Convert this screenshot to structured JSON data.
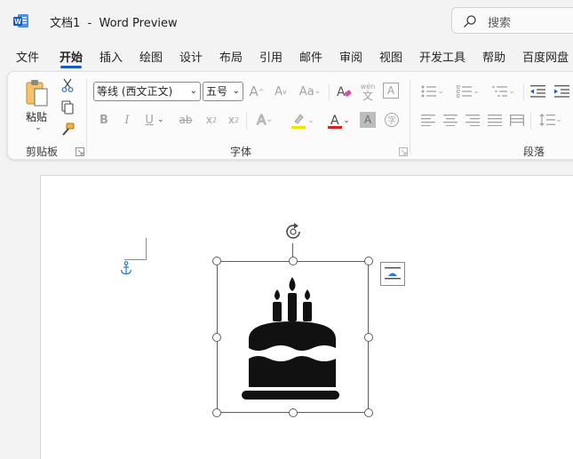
{
  "titlebar": {
    "doc_name": "文档1",
    "separator": "-",
    "app_name": "Word Preview",
    "search_placeholder": "搜索"
  },
  "tabs": [
    {
      "label": "文件",
      "active": false
    },
    {
      "label": "开始",
      "active": true
    },
    {
      "label": "插入",
      "active": false
    },
    {
      "label": "绘图",
      "active": false
    },
    {
      "label": "设计",
      "active": false
    },
    {
      "label": "布局",
      "active": false
    },
    {
      "label": "引用",
      "active": false
    },
    {
      "label": "邮件",
      "active": false
    },
    {
      "label": "审阅",
      "active": false
    },
    {
      "label": "视图",
      "active": false
    },
    {
      "label": "开发工具",
      "active": false
    },
    {
      "label": "帮助",
      "active": false
    },
    {
      "label": "百度网盘",
      "active": false
    }
  ],
  "ribbon": {
    "clipboard": {
      "paste_label": "粘贴",
      "group_label": "剪贴板"
    },
    "font": {
      "font_name": "等线 (西文正文)",
      "font_size": "五号",
      "group_label": "字体",
      "grow_font": "A",
      "shrink_font": "A",
      "change_case": "Aa",
      "phonetic_top": "wén",
      "phonetic_bottom": "文",
      "char_border": "A",
      "bold": "B",
      "italic": "I",
      "underline": "U",
      "strikethrough": "ab",
      "subscript": "x",
      "subscript_sub": "2",
      "superscript": "x",
      "superscript_sup": "2",
      "text_effects": "A",
      "font_color": "A",
      "char_shading": "A",
      "enclose_char": "字"
    },
    "paragraph": {
      "group_label": "段落"
    }
  },
  "colors": {
    "accent": "#185abd",
    "highlight": "#f2e600",
    "font_color": "#e02020",
    "anchor": "#2b79d1",
    "word_blue": "#185abd"
  },
  "document": {
    "image_name": "birthday-cake-icon"
  }
}
